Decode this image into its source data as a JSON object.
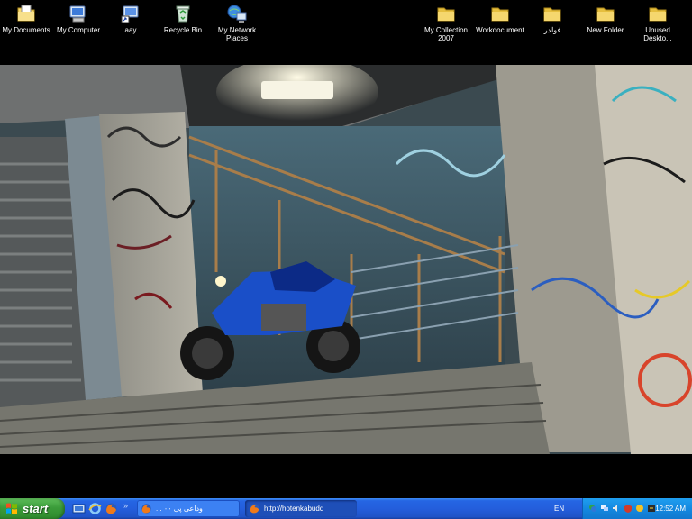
{
  "desktop": {
    "left_icons": [
      {
        "label": "My Documents",
        "icon": "my-documents-icon"
      },
      {
        "label": "My Computer",
        "icon": "my-computer-icon"
      },
      {
        "label": "aay",
        "icon": "computer-shortcut-icon"
      },
      {
        "label": "Recycle Bin",
        "icon": "recycle-bin-icon"
      },
      {
        "label": "My Network Places",
        "icon": "network-places-icon"
      }
    ],
    "right_icons": [
      {
        "label": "My Collection 2007",
        "icon": "folder-icon"
      },
      {
        "label": "Workdocument",
        "icon": "folder-icon"
      },
      {
        "label": "فولدر",
        "icon": "folder-icon"
      },
      {
        "label": "New Folder",
        "icon": "folder-icon"
      },
      {
        "label": "Unused Deskto...",
        "icon": "folder-icon"
      }
    ]
  },
  "taskbar": {
    "start_label": "start",
    "quick_launch": [
      "show-desktop-icon",
      "ie-icon",
      "firefox-icon"
    ],
    "tasks": [
      {
        "label": "... وداعی پی ۰۰",
        "icon": "firefox-icon",
        "active": false
      },
      {
        "label": "http://hotenkabudd",
        "icon": "firefox-icon",
        "active": true
      }
    ],
    "language": "EN",
    "tray_icons": [
      "messenger-icon",
      "network-icon",
      "volume-icon",
      "security-icon",
      "update-icon",
      "antivirus-icon"
    ],
    "clock": "12:52 AM"
  },
  "colors": {
    "taskbar_blue": "#245edc",
    "start_green": "#3b9c3a",
    "tray_blue": "#1489e0",
    "folder_yellow": "#f5d76e"
  }
}
